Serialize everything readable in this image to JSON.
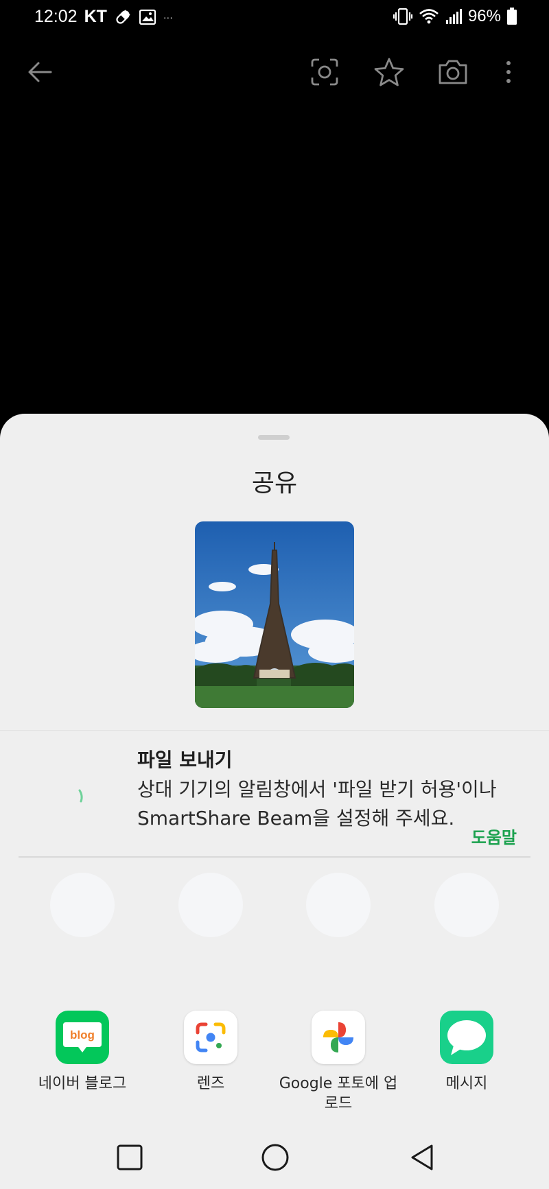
{
  "status_bar": {
    "time": "12:02",
    "carrier": "KT",
    "overflow": "···",
    "battery": "96%",
    "icons": [
      "pill-icon",
      "image-icon",
      "vibrate-icon",
      "wifi-icon",
      "signal-icon",
      "battery-icon"
    ]
  },
  "toolbar": {
    "icons": [
      "back-arrow-icon",
      "lens-scan-icon",
      "star-icon",
      "camera-icon",
      "more-vert-icon"
    ]
  },
  "sheet": {
    "title": "공유",
    "file_send": {
      "title": "파일 보내기",
      "description": "상대 기기의 알림창에서 '파일 받기 허용'이나 SmartShare Beam을 설정해 주세요.",
      "help": "도움말"
    },
    "apps": [
      {
        "label": "네이버 블로그",
        "icon": "naver-blog-icon",
        "icon_text": "blog",
        "color": "#03c75a"
      },
      {
        "label": "렌즈",
        "icon": "google-lens-icon",
        "color": "#ffffff"
      },
      {
        "label": "Google 포토에 업로드",
        "icon": "google-photos-icon",
        "color": "#ffffff"
      },
      {
        "label": "메시지",
        "icon": "messages-icon",
        "color": "#19d08a"
      }
    ]
  },
  "nav_bar": {
    "icons": [
      "recents-square-icon",
      "home-circle-icon",
      "back-triangle-icon"
    ]
  },
  "colors": {
    "sheet_bg": "#efefef",
    "help_link": "#1aa14e"
  }
}
